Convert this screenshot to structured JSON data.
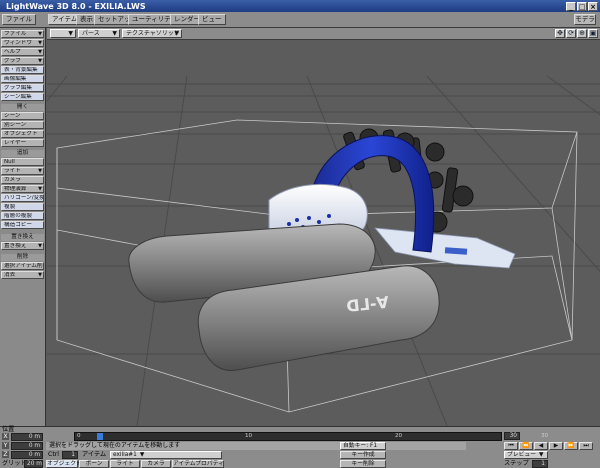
{
  "window": {
    "title": "LightWave 3D 8.0 - EXILIA.LWS",
    "minimize": "_",
    "maximize": "□",
    "close": "×"
  },
  "menu_tabs": [
    {
      "label": "ファイル"
    },
    {
      "label": "アイテム"
    },
    {
      "label": "表示"
    },
    {
      "label": "セットアップ"
    },
    {
      "label": "ユーティリティ"
    },
    {
      "label": "レンダー"
    },
    {
      "label": "ビュー"
    }
  ],
  "mode_button": "モデラ",
  "sidebar": {
    "top_items": [
      "ファイル",
      "ウィンドウ",
      "ヘルプ",
      "グラフ",
      "表・背景編集",
      "画像編集",
      "グラフ編集",
      "シーン編集"
    ],
    "sections": [
      {
        "header": "開く",
        "items": [
          "シーン",
          "別シーン",
          "オブジェクト",
          "レイヤー"
        ]
      },
      {
        "header": "追加",
        "items": [
          "Null",
          "ライト",
          "カメラ",
          "物理演算",
          "ハリゴーン/変換",
          "複製",
          "階層の複製",
          "構造コピー"
        ]
      },
      {
        "header": "置き換え",
        "items": [
          "置き換え"
        ]
      },
      {
        "header": "削除",
        "items": [
          "選択アイテム削除",
          "消去"
        ]
      }
    ]
  },
  "viewport": {
    "view_mode": "パース",
    "shading_mode": "テクスチャソリッド",
    "small_dd": "",
    "icons": [
      "move-view-icon",
      "rotate-view-icon",
      "zoom-view-icon",
      "maximize-view-icon"
    ],
    "object_lettering": "ᗡ⅃-∀"
  },
  "timeline": {
    "position_label": "位置",
    "axes": [
      {
        "label": "X",
        "value": "0 m"
      },
      {
        "label": "Y",
        "value": "0 m"
      },
      {
        "label": "Z",
        "value": "0 m"
      }
    ],
    "grid_label": "グリッド",
    "grid_value": "20 m",
    "ruler_ticks": [
      "0",
      "10",
      "20",
      "30"
    ],
    "ruler_end": "30",
    "status_text": "選択をドラッグして現在のアイテムを移動します",
    "current_label": "Ctrl",
    "current_value": "1",
    "item_label": "アイテム",
    "item_value": "exilia#1",
    "bottom_buttons": [
      "オブジェクト",
      "ボーン",
      "ライト",
      "カメラ",
      "アイテムプロパティ"
    ],
    "autokey_label": "自動キー:",
    "autokey_value": "F1",
    "create_key": "キー作成",
    "delete_key": "キー削除",
    "playback_buttons": [
      "⏮",
      "⏪",
      "◀",
      "▶",
      "⏩",
      "⏭"
    ],
    "preview_label": "プレビュー",
    "step_label": "ステップ",
    "step_value": "1"
  }
}
